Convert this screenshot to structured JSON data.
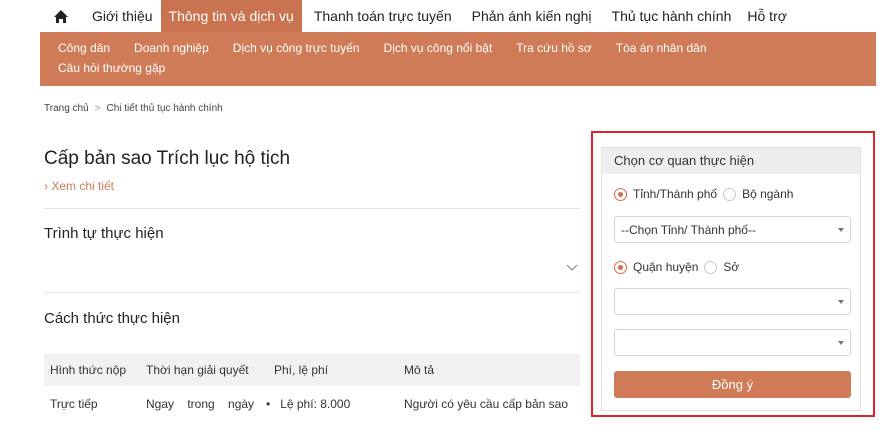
{
  "topnav": {
    "items": [
      "Giới thiệu",
      "Thông tin và dịch vụ",
      "Thanh toán trực tuyến",
      "Phản ánh kiến nghị",
      "Thủ tục hành chính",
      "Hỗ trợ"
    ]
  },
  "subnav": {
    "row1": [
      "Công dân",
      "Doanh nghiệp",
      "Dịch vụ công trực tuyến",
      "Dịch vụ công nổi bật",
      "Tra cứu hồ sơ",
      "Tòa án nhân dân"
    ],
    "row2": [
      "Câu hỏi thường gặp"
    ]
  },
  "breadcrumb": {
    "home": "Trang chủ",
    "sep": ">",
    "current": "Chi tiết thủ tục hành chính"
  },
  "page": {
    "title": "Cấp bản sao Trích lục hộ tịch",
    "detail_link": "›  Xem chi tiết",
    "section1": "Trình tự thực hiện",
    "section2": "Cách thức thực hiện"
  },
  "table": {
    "headers": [
      "Hình thức nộp",
      "Thời hạn giải quyết",
      "Phí, lệ phí",
      "Mô tả"
    ],
    "row1": [
      "Trực tiếp",
      "Ngay    trong    ngày",
      "•   Lệ phí: 8.000",
      "Người có yêu cầu cấp bản sao"
    ]
  },
  "panel": {
    "title": "Chọn cơ quan thực hiện",
    "radio1_a": "Tỉnh/Thành phố",
    "radio1_b": "Bộ ngành",
    "select1": "--Chọn Tỉnh/ Thành phố--",
    "radio2_a": "Quận huyện",
    "radio2_b": "Sở",
    "select2": "",
    "select3": "",
    "submit": "Đồng ý"
  },
  "colors": {
    "brand": "#cf7b57",
    "highlight": "#d9262c"
  }
}
